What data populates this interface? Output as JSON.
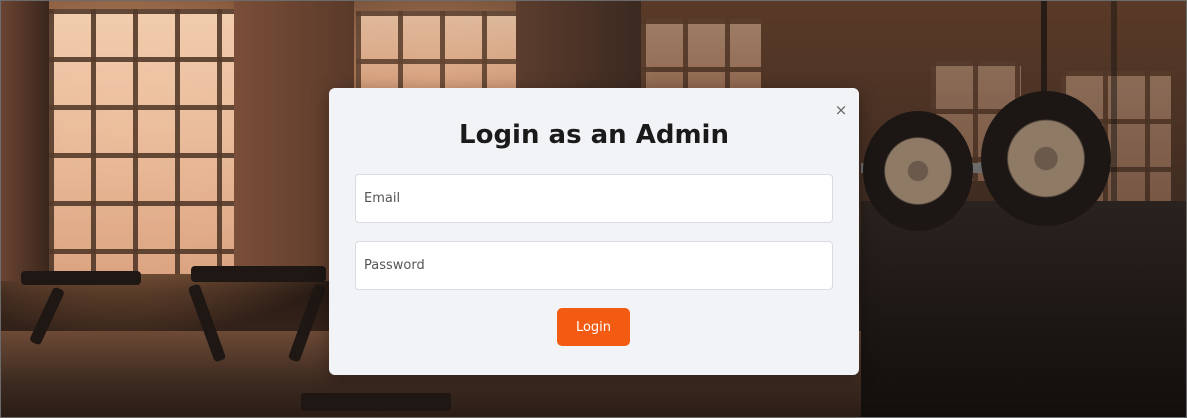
{
  "modal": {
    "title": "Login as an Admin",
    "close_icon": "close-icon",
    "close_glyph": "×",
    "email": {
      "placeholder": "Email",
      "value": ""
    },
    "password": {
      "placeholder": "Password",
      "value": ""
    },
    "login_label": "Login"
  },
  "colors": {
    "accent": "#f35b12",
    "modal_bg": "#f2f3f7",
    "title_text": "#1a1a1a"
  }
}
